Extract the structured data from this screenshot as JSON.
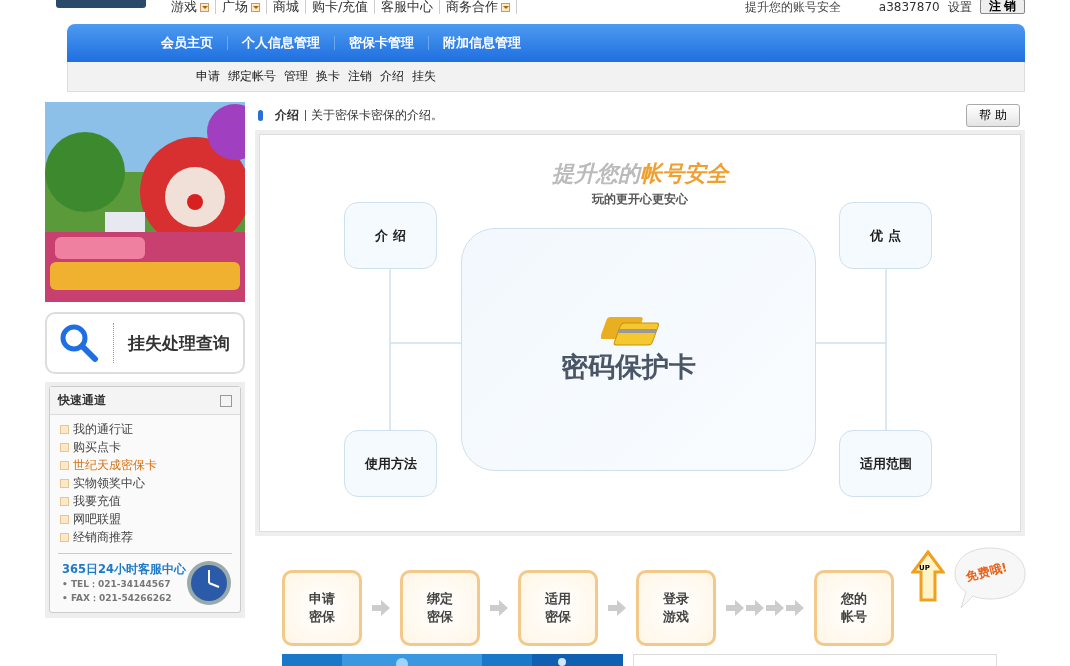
{
  "top_nav": [
    {
      "label": "游戏",
      "dropdown": true
    },
    {
      "label": "广场",
      "dropdown": true
    },
    {
      "label": "商城",
      "dropdown": false
    },
    {
      "label": "购卡/充值",
      "dropdown": false
    },
    {
      "label": "客服中心",
      "dropdown": false
    },
    {
      "label": "商务合作",
      "dropdown": true
    }
  ],
  "top_right": {
    "slogan": "提升您的账号安全",
    "username": "a3837870",
    "settings": "设置",
    "logout": "注 销"
  },
  "main_tabs": [
    "会员主页",
    "个人信息管理",
    "密保卡管理",
    "附加信息管理"
  ],
  "sub_nav": [
    "申请",
    "绑定帐号",
    "管理",
    "换卡",
    "注销",
    "介绍",
    "挂失"
  ],
  "side": {
    "lost_query": "挂失处理查询",
    "quick_title": "快速通道",
    "quick_links": [
      {
        "label": "我的通行证",
        "selected": false
      },
      {
        "label": "购买点卡",
        "selected": false
      },
      {
        "label": "世纪天成密保卡",
        "selected": true
      },
      {
        "label": "实物领奖中心",
        "selected": false
      },
      {
        "label": "我要充值",
        "selected": false
      },
      {
        "label": "网吧联盟",
        "selected": false
      },
      {
        "label": "经销商推荐",
        "selected": false
      }
    ],
    "service_title": "365日24小时客服中心",
    "tel": "• TEL：021-34144567",
    "fax": "• FAX：021-54266262"
  },
  "section": {
    "title": "介绍",
    "desc": "关于密保卡密保的介绍。",
    "help": "帮 助"
  },
  "diagram": {
    "headline_gray": "提升您的",
    "headline_orange": "帐号安全",
    "subline": "玩的更开心更安心",
    "center": "密码保护卡",
    "nodes": [
      "介 绍",
      "优 点",
      "使用方法",
      "适用范围"
    ]
  },
  "steps": [
    {
      "lines": [
        "申请",
        "密保"
      ],
      "kind": "single"
    },
    {
      "lines": [
        "绑定",
        "密保"
      ],
      "kind": "single"
    },
    {
      "lines": [
        "适用",
        "密保"
      ],
      "kind": "single"
    },
    {
      "lines": [
        "登录",
        "游戏"
      ],
      "kind": "quad"
    },
    {
      "lines": [
        "您的",
        "帐号"
      ],
      "kind": "last"
    }
  ],
  "up_badge": "UP",
  "free_bubble": "免费哦!"
}
